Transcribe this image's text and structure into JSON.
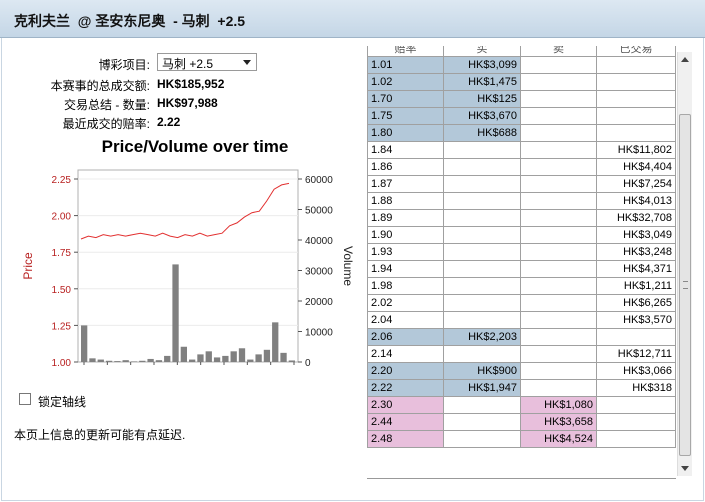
{
  "title": "克利夫兰  @ 圣安东尼奥  - 马刺  +2.5",
  "form": {
    "bet_item_label": "博彩项目:",
    "bet_item_value": "马刺 +2.5",
    "total_label": "本赛事的总成交额:",
    "total_value": "HK$185,952",
    "qty_label": "交易总结 - 数量:",
    "qty_value": "HK$97,988",
    "last_label": "最近成交的赔率:",
    "last_value": "2.22"
  },
  "chart_title": "Price/Volume over time",
  "chart_data": {
    "type": "line",
    "title": "Price/Volume over time",
    "ylabel_left": "Price",
    "ylabel_right": "Volume",
    "yticks_left": [
      "2.25",
      "2.00",
      "1.75",
      "1.50",
      "1.25",
      "1.00"
    ],
    "yticks_right": [
      "60000",
      "50000",
      "40000",
      "30000",
      "20000",
      "10000",
      "0"
    ],
    "ylim_left": [
      1.0,
      2.3
    ],
    "ylim_right": [
      0,
      62000
    ],
    "price": [
      1.84,
      1.86,
      1.85,
      1.87,
      1.86,
      1.87,
      1.86,
      1.87,
      1.88,
      1.87,
      1.86,
      1.88,
      1.86,
      1.85,
      1.87,
      1.86,
      1.88,
      1.86,
      1.87,
      1.88,
      1.93,
      1.95,
      1.99,
      2.02,
      2.03,
      2.1,
      2.18,
      2.21,
      2.22
    ],
    "volume": [
      12000,
      1200,
      800,
      400,
      300,
      600,
      200,
      400,
      1000,
      600,
      2000,
      32000,
      5000,
      800,
      2500,
      3500,
      1500,
      2000,
      3500,
      4500,
      800,
      2500,
      4000,
      13000,
      3000,
      500
    ],
    "colors": {
      "price": "#e23030",
      "volume": "#808080"
    }
  },
  "lock_axis_label": "锁定轴线",
  "notice": "本页上信息的更新可能有点延迟.",
  "odds_table": {
    "headers": [
      "赔率",
      "买",
      "卖",
      "已交易"
    ],
    "rows": [
      {
        "odds": "1.01",
        "back": "HK$3,099",
        "lay": "",
        "matched": "",
        "kind": "back"
      },
      {
        "odds": "1.02",
        "back": "HK$1,475",
        "lay": "",
        "matched": "",
        "kind": "back"
      },
      {
        "odds": "1.70",
        "back": "HK$125",
        "lay": "",
        "matched": "",
        "kind": "back"
      },
      {
        "odds": "1.75",
        "back": "HK$3,670",
        "lay": "",
        "matched": "",
        "kind": "back"
      },
      {
        "odds": "1.80",
        "back": "HK$688",
        "lay": "",
        "matched": "",
        "kind": "back"
      },
      {
        "odds": "1.84",
        "back": "",
        "lay": "",
        "matched": "HK$11,802",
        "kind": ""
      },
      {
        "odds": "1.86",
        "back": "",
        "lay": "",
        "matched": "HK$4,404",
        "kind": ""
      },
      {
        "odds": "1.87",
        "back": "",
        "lay": "",
        "matched": "HK$7,254",
        "kind": ""
      },
      {
        "odds": "1.88",
        "back": "",
        "lay": "",
        "matched": "HK$4,013",
        "kind": ""
      },
      {
        "odds": "1.89",
        "back": "",
        "lay": "",
        "matched": "HK$32,708",
        "kind": ""
      },
      {
        "odds": "1.90",
        "back": "",
        "lay": "",
        "matched": "HK$3,049",
        "kind": ""
      },
      {
        "odds": "1.93",
        "back": "",
        "lay": "",
        "matched": "HK$3,248",
        "kind": ""
      },
      {
        "odds": "1.94",
        "back": "",
        "lay": "",
        "matched": "HK$4,371",
        "kind": ""
      },
      {
        "odds": "1.98",
        "back": "",
        "lay": "",
        "matched": "HK$1,211",
        "kind": ""
      },
      {
        "odds": "2.02",
        "back": "",
        "lay": "",
        "matched": "HK$6,265",
        "kind": ""
      },
      {
        "odds": "2.04",
        "back": "",
        "lay": "",
        "matched": "HK$3,570",
        "kind": ""
      },
      {
        "odds": "2.06",
        "back": "HK$2,203",
        "lay": "",
        "matched": "",
        "kind": "back"
      },
      {
        "odds": "2.14",
        "back": "",
        "lay": "",
        "matched": "HK$12,711",
        "kind": ""
      },
      {
        "odds": "2.20",
        "back": "HK$900",
        "lay": "",
        "matched": "HK$3,066",
        "kind": "back"
      },
      {
        "odds": "2.22",
        "back": "HK$1,947",
        "lay": "",
        "matched": "HK$318",
        "kind": "back"
      },
      {
        "odds": "2.30",
        "back": "",
        "lay": "HK$1,080",
        "matched": "",
        "kind": "lay"
      },
      {
        "odds": "2.44",
        "back": "",
        "lay": "HK$3,658",
        "matched": "",
        "kind": "lay"
      },
      {
        "odds": "2.48",
        "back": "",
        "lay": "HK$4,524",
        "matched": "",
        "kind": "lay"
      }
    ]
  },
  "colors": {
    "back": "#b3c8d9",
    "lay": "#e8bfdc"
  }
}
